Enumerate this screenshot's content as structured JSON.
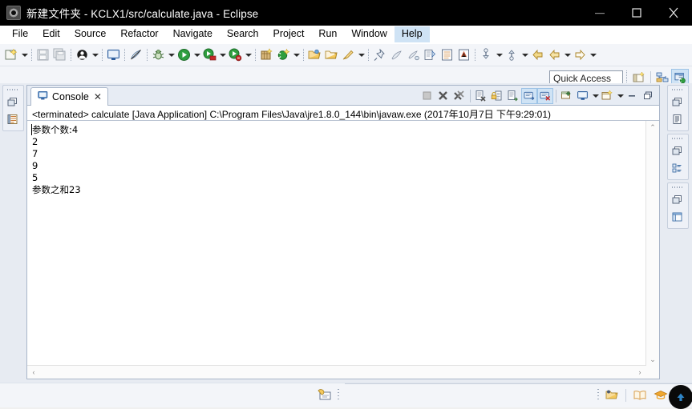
{
  "window": {
    "title": "新建文件夹 - KCLX1/src/calculate.java - Eclipse",
    "app_icon": "eclipse-icon",
    "controls": {
      "minimize": "minimize-button",
      "maximize": "maximize-button",
      "close": "close-button"
    }
  },
  "menubar": {
    "items": [
      {
        "label": "File"
      },
      {
        "label": "Edit"
      },
      {
        "label": "Source"
      },
      {
        "label": "Refactor"
      },
      {
        "label": "Navigate"
      },
      {
        "label": "Search"
      },
      {
        "label": "Project"
      },
      {
        "label": "Run"
      },
      {
        "label": "Window"
      },
      {
        "label": "Help",
        "active": true
      }
    ]
  },
  "toolbar": {
    "items": [
      {
        "name": "new-wizard-icon",
        "type": "button"
      },
      {
        "name": "new-wizard-dropdown-icon",
        "type": "arrow"
      },
      {
        "name": "separator",
        "type": "sep"
      },
      {
        "name": "save-icon",
        "type": "button"
      },
      {
        "name": "save-all-icon",
        "type": "button"
      },
      {
        "name": "separator",
        "type": "sep"
      },
      {
        "name": "toggle-breakpoint-icon",
        "type": "button"
      },
      {
        "name": "breakpoint-dropdown-icon",
        "type": "arrow"
      },
      {
        "name": "separator",
        "type": "sep"
      },
      {
        "name": "open-console-icon",
        "type": "button"
      },
      {
        "name": "separator",
        "type": "sep"
      },
      {
        "name": "skip-breakpoints-icon",
        "type": "button"
      },
      {
        "name": "separator",
        "type": "sep"
      },
      {
        "name": "debug-icon",
        "type": "button"
      },
      {
        "name": "debug-dropdown-icon",
        "type": "arrow"
      },
      {
        "name": "run-icon",
        "type": "button"
      },
      {
        "name": "run-dropdown-icon",
        "type": "arrow"
      },
      {
        "name": "external-tools-icon",
        "type": "button"
      },
      {
        "name": "external-tools-dropdown-icon",
        "type": "arrow"
      },
      {
        "name": "coverage-icon",
        "type": "button"
      },
      {
        "name": "coverage-dropdown-icon",
        "type": "arrow"
      },
      {
        "name": "separator",
        "type": "sep"
      },
      {
        "name": "new-java-package-icon",
        "type": "button"
      },
      {
        "name": "new-java-class-icon",
        "type": "button"
      },
      {
        "name": "new-class-dropdown-icon",
        "type": "arrow"
      },
      {
        "name": "separator",
        "type": "sep"
      },
      {
        "name": "open-type-icon",
        "type": "button"
      },
      {
        "name": "open-task-icon",
        "type": "button"
      },
      {
        "name": "search-icon",
        "type": "button"
      },
      {
        "name": "search-dropdown-icon",
        "type": "arrow"
      },
      {
        "name": "separator",
        "type": "sep"
      },
      {
        "name": "pin-editor-icon",
        "type": "button"
      },
      {
        "name": "next-annotation-icon",
        "type": "button"
      },
      {
        "name": "previous-annotation-icon",
        "type": "button"
      },
      {
        "name": "last-edit-location-icon",
        "type": "button"
      },
      {
        "name": "toggle-mark-occurrences-icon",
        "type": "button"
      },
      {
        "name": "show-whitespace-icon",
        "type": "button"
      },
      {
        "name": "separator",
        "type": "sep"
      },
      {
        "name": "next-edit-icon",
        "type": "button"
      },
      {
        "name": "next-edit-dropdown-icon",
        "type": "arrow"
      },
      {
        "name": "previous-edit-icon",
        "type": "button"
      },
      {
        "name": "previous-edit-dropdown-icon",
        "type": "arrow"
      },
      {
        "name": "back-icon",
        "type": "button"
      },
      {
        "name": "back-history-icon",
        "type": "button"
      },
      {
        "name": "back-dropdown-icon",
        "type": "arrow"
      },
      {
        "name": "forward-icon",
        "type": "button"
      },
      {
        "name": "forward-dropdown-icon",
        "type": "arrow"
      }
    ]
  },
  "quick_access": {
    "placeholder": "Quick Access",
    "value": "Quick Access",
    "open_perspective_icon": "open-perspective-icon",
    "perspectives": [
      {
        "name": "perspective-java-ee-icon",
        "selected": false
      },
      {
        "name": "perspective-java-icon",
        "selected": true
      }
    ]
  },
  "left_fastview": {
    "groups": [
      {
        "handle": "drag-handle",
        "buttons": [
          {
            "name": "restore-icon"
          },
          {
            "name": "package-explorer-icon"
          }
        ]
      }
    ]
  },
  "right_fastview": {
    "groups": [
      {
        "handle": "drag-handle",
        "buttons": [
          {
            "name": "restore-icon"
          },
          {
            "name": "task-list-icon"
          }
        ]
      },
      {
        "handle": "drag-handle",
        "buttons": [
          {
            "name": "restore-icon"
          },
          {
            "name": "outline-icon"
          }
        ]
      },
      {
        "handle": "drag-handle",
        "buttons": [
          {
            "name": "restore-icon"
          },
          {
            "name": "templates-view-icon"
          }
        ]
      }
    ]
  },
  "console_view": {
    "tab": {
      "icon": "console-icon",
      "label": "Console",
      "close_glyph": "✕",
      "active": true
    },
    "view_toolbar": [
      {
        "name": "terminate-icon",
        "enabled": false,
        "selected": false
      },
      {
        "name": "remove-launch-icon",
        "enabled": true,
        "selected": false
      },
      {
        "name": "remove-all-terminated-icon",
        "enabled": true,
        "selected": false
      },
      {
        "name": "separator",
        "type": "sep"
      },
      {
        "name": "clear-console-icon",
        "enabled": true,
        "selected": false
      },
      {
        "name": "scroll-lock-icon",
        "enabled": true,
        "selected": false
      },
      {
        "name": "word-wrap-icon",
        "enabled": true,
        "selected": false
      },
      {
        "name": "show-console-on-output-icon",
        "enabled": true,
        "selected": true
      },
      {
        "name": "show-console-on-error-icon",
        "enabled": true,
        "selected": true
      },
      {
        "name": "separator",
        "type": "sep"
      },
      {
        "name": "pin-console-icon",
        "enabled": true,
        "selected": false
      },
      {
        "name": "display-selected-console-icon",
        "enabled": true,
        "selected": false
      },
      {
        "name": "display-selected-console-dropdown-icon",
        "type": "arrow"
      },
      {
        "name": "open-console-icon",
        "enabled": true,
        "selected": false
      },
      {
        "name": "open-console-dropdown-icon",
        "type": "arrow"
      },
      {
        "name": "minimize-view-icon",
        "enabled": true,
        "selected": false
      },
      {
        "name": "maximize-view-icon",
        "enabled": true,
        "selected": false
      }
    ],
    "header": "<terminated> calculate [Java Application] C:\\Program Files\\Java\\jre1.8.0_144\\bin\\javaw.exe (2017年10月7日 下午9:29:01)",
    "output_lines": [
      "参数个数:4",
      "2",
      "7",
      "9",
      "5",
      "参数之和23"
    ],
    "scrollbars": {
      "vertical": {
        "up_glyph": "⌃",
        "down_glyph": "⌄"
      },
      "horizontal": {
        "left_glyph": "‹",
        "right_glyph": "›"
      }
    }
  },
  "statusbar": {
    "left_items": [
      {
        "name": "smart-insert-icon"
      }
    ],
    "right_items": [
      {
        "name": "build-status-icon"
      },
      {
        "name": "open-book-icon"
      },
      {
        "name": "mortarboard-icon"
      },
      {
        "name": "pencil-icon"
      }
    ],
    "scroll_to_top_button": "scroll-to-top-button"
  },
  "colors": {
    "title_bar_bg": "#000000",
    "toolbar_bg": "#f3f5f9",
    "workbench_bg": "#e7ebf2",
    "tab_selected_bg": "#ffffff",
    "selection_blue": "#cfe3f5",
    "border": "#a9b6c9"
  }
}
